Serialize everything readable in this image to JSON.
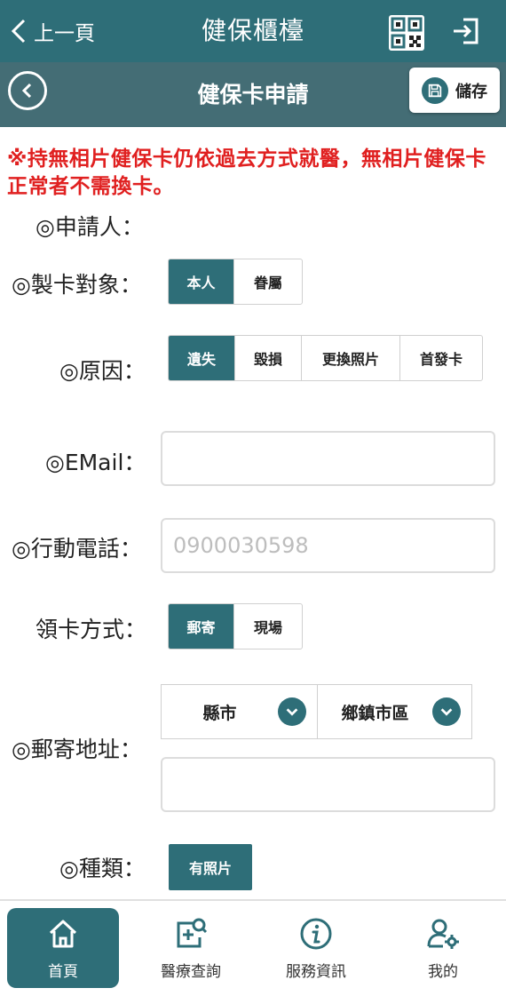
{
  "header": {
    "back_label": "上一頁",
    "app_title": "健保櫃檯"
  },
  "subheader": {
    "title": "健保卡申請",
    "save_label": "儲存"
  },
  "notice": "※持無相片健保卡仍依過去方式就醫，無相片健保卡正常者不需換卡。",
  "form": {
    "applicant": {
      "label": "◎申請人："
    },
    "card_target": {
      "label": "◎製卡對象：",
      "options": [
        "本人",
        "眷屬"
      ],
      "selected": "本人"
    },
    "reason": {
      "label": "◎原因：",
      "options": [
        "遺失",
        "毀損",
        "更換照片",
        "首發卡"
      ],
      "selected": "遺失"
    },
    "email": {
      "label": "◎EMail：",
      "value": "",
      "placeholder": ""
    },
    "mobile": {
      "label": "◎行動電話：",
      "value": "",
      "placeholder": "0900030598"
    },
    "pickup": {
      "label": "領卡方式：",
      "options": [
        "郵寄",
        "現場"
      ],
      "selected": "郵寄"
    },
    "address": {
      "label": "◎郵寄地址：",
      "county": "縣市",
      "district": "鄉鎮市區",
      "detail_value": ""
    },
    "type": {
      "label": "◎種類：",
      "option": "有照片"
    }
  },
  "bottom_nav": [
    {
      "label": "首頁",
      "icon": "home-icon",
      "active": true
    },
    {
      "label": "醫療查詢",
      "icon": "medical-search-icon",
      "active": false
    },
    {
      "label": "服務資訊",
      "icon": "info-icon",
      "active": false
    },
    {
      "label": "我的",
      "icon": "user-settings-icon",
      "active": false
    }
  ],
  "colors": {
    "primary": "#2e6e78",
    "subheader": "#446d75",
    "notice": "#e02020"
  }
}
